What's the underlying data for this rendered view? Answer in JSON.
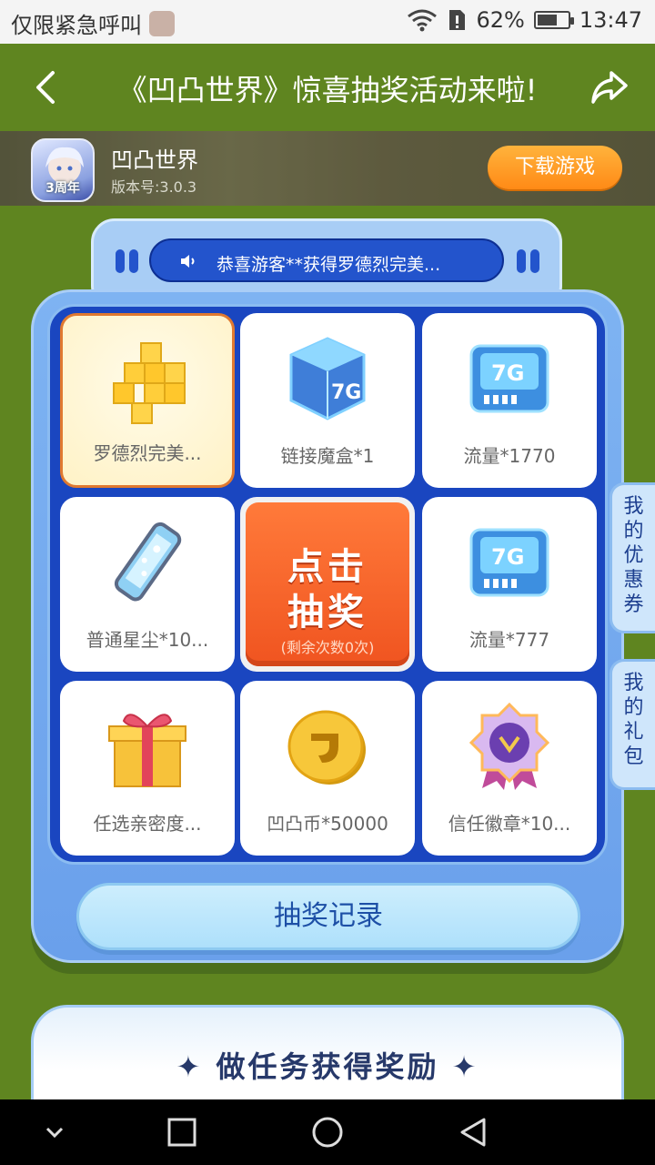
{
  "status_bar": {
    "carrier_text": "仅限紧急呼叫",
    "battery": "62%",
    "battery_level": 0.62,
    "time": "13:47"
  },
  "title_bar": {
    "title": "《凹凸世界》惊喜抽奖活动来啦!"
  },
  "game": {
    "name": "凹凸世界",
    "version": "版本号:3.0.3",
    "icon_badge": "3周年",
    "download_label": "下载游戏"
  },
  "ticker": {
    "message": "恭喜游客**获得罗德烈完美..."
  },
  "prizes": [
    {
      "label": "罗德烈完美...",
      "icon": "gold-blocks-icon",
      "active": true
    },
    {
      "label": "链接魔盒*1",
      "icon": "magic-cube-7g-icon"
    },
    {
      "label": "流量*1770",
      "icon": "data-card-7g-icon"
    },
    {
      "label": "普通星尘*10...",
      "icon": "stardust-crystal-icon"
    },
    {
      "label": "流量*777",
      "icon": "data-card-7g-icon"
    },
    {
      "label": "任选亲密度...",
      "icon": "gift-box-icon"
    },
    {
      "label": "凹凸币*50000",
      "icon": "gold-coin-icon"
    },
    {
      "label": "信任徽章*10...",
      "icon": "trust-badge-icon"
    }
  ],
  "draw_button": {
    "line1": "点击",
    "line2": "抽奖",
    "remaining": "(剩余次数0次)"
  },
  "record_button": "抽奖记录",
  "side_tabs": {
    "coupons": "我的优惠券",
    "gifts": "我的礼包"
  },
  "task_section": {
    "title": "✦ 做任务获得奖励 ✦"
  },
  "colors": {
    "page_bg": "#5f8520",
    "grid_bg": "#1a46c0",
    "draw_button": "#f05420",
    "download_button": "#ff8a16"
  }
}
